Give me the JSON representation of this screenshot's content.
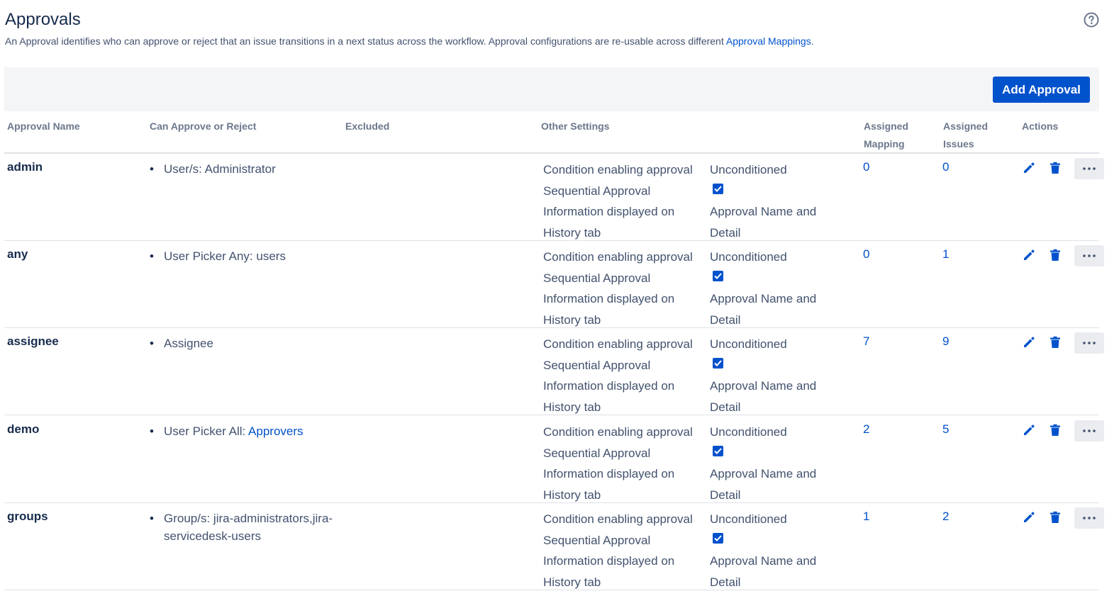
{
  "page": {
    "title": "Approvals",
    "description": "An Approval identifies who can approve or reject that an issue transitions in a next status across the workflow. Approval configurations are re-usable across different",
    "description_link": "Approval Mappings",
    "description_end": "."
  },
  "toolbar": {
    "add_label": "Add Approval"
  },
  "columns": {
    "name": "Approval Name",
    "who": "Can Approve or Reject",
    "excluded": "Excluded",
    "other": "Other Settings",
    "mapping_1": "Assigned",
    "mapping_2": "Mapping",
    "issues_1": "Assigned",
    "issues_2": "Issues",
    "actions": "Actions"
  },
  "settings_labels": {
    "condition": "Condition enabling approval",
    "sequential": "Sequential Approval",
    "info_1": "Information displayed on",
    "info_2": "History tab"
  },
  "rows": [
    {
      "name": "admin",
      "who": "User/s: Administrator",
      "who_link": "",
      "condition": "Unconditioned",
      "sequential": true,
      "info_1": "Approval Name and",
      "info_2": "Detail",
      "mapping": "0",
      "issues": "0"
    },
    {
      "name": "any",
      "who": "User Picker Any: users",
      "who_link": "",
      "condition": "Unconditioned",
      "sequential": true,
      "info_1": "Approval Name and",
      "info_2": "Detail",
      "mapping": "0",
      "issues": "1"
    },
    {
      "name": "assignee",
      "who": "Assignee",
      "who_link": "",
      "condition": "Unconditioned",
      "sequential": true,
      "info_1": "Approval Name and",
      "info_2": "Detail",
      "mapping": "7",
      "issues": "9"
    },
    {
      "name": "demo",
      "who": "User Picker All: ",
      "who_link": "Approvers",
      "condition": "Unconditioned",
      "sequential": true,
      "info_1": "Approval Name and",
      "info_2": "Detail",
      "mapping": "2",
      "issues": "5"
    },
    {
      "name": "groups",
      "who": "Group/s: jira-administrators,jira-servicedesk-users",
      "who_link": "",
      "condition": "Unconditioned",
      "sequential": true,
      "info_1": "Approval Name and",
      "info_2": "Detail",
      "mapping": "1",
      "issues": "2"
    }
  ],
  "icons": {
    "help": "help-circle-icon",
    "edit": "pencil-icon",
    "delete": "trash-icon",
    "more": "more-horizontal-icon"
  },
  "colors": {
    "primary": "#0052cc",
    "toolbar_bg": "#f4f5f7"
  }
}
